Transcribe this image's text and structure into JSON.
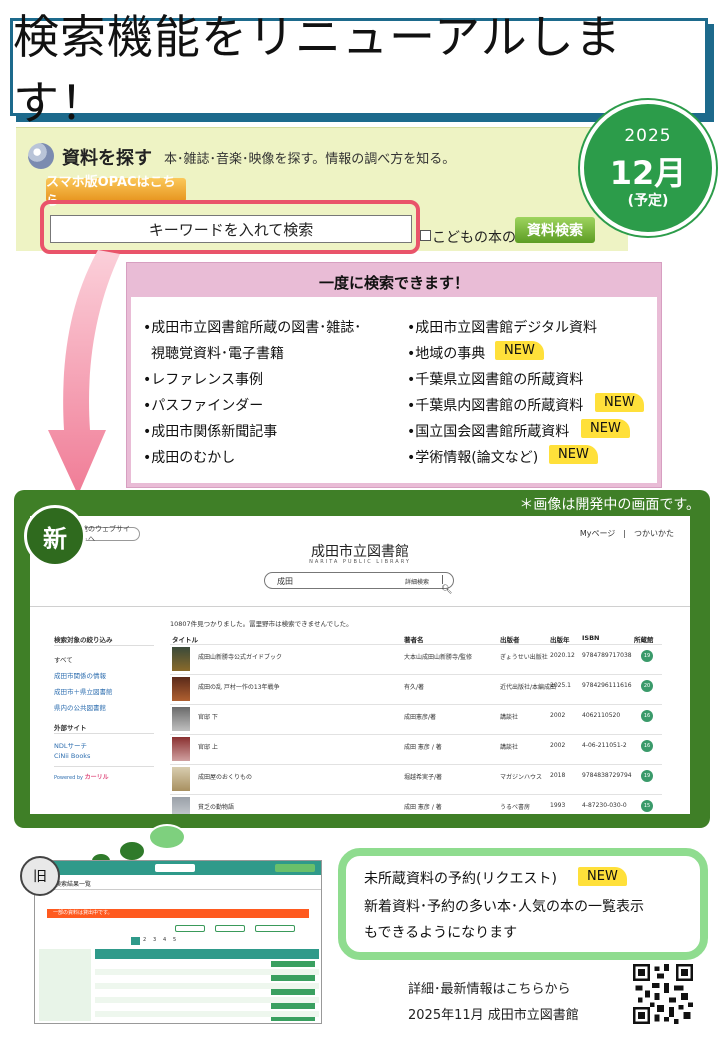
{
  "title": "検索機能をリニューアルします！",
  "old_opac": {
    "heading": "資料を探す",
    "subheading": "本･雑誌･音楽･映像を探す。情報の調べ方を知る。",
    "smartphone_button": "スマホ版OPACはこちら",
    "search_placeholder": "キーワードを入れて検索",
    "kids_only_label": "こどもの本のみ",
    "search_button": "資料検索"
  },
  "release_badge": {
    "year": "2025",
    "month": "12月",
    "note": "(予定)"
  },
  "features": {
    "header": "一度に検索できます！",
    "new_badge_label": "NEW",
    "left": [
      {
        "text": "•成田市立図書館所蔵の図書･雑誌･"
      },
      {
        "text": "視聴覚資料･電子書籍"
      },
      {
        "text": "•レファレンス事例"
      },
      {
        "text": "•パスファインダー"
      },
      {
        "text": "•成田市関係新聞記事"
      },
      {
        "text": "•成田のむかし"
      }
    ],
    "right": [
      {
        "text": "•成田市立図書館デジタル資料",
        "is_new": false
      },
      {
        "text": "•地域の事典",
        "is_new": true
      },
      {
        "text": "•千葉県立図書館の所蔵資料",
        "is_new": false
      },
      {
        "text": "•千葉県内図書館の所蔵資料",
        "is_new": true
      },
      {
        "text": "•国立国会図書館所蔵資料",
        "is_new": true
      },
      {
        "text": "•学術情報(論文など)",
        "is_new": true
      }
    ]
  },
  "new_screen": {
    "badge": "新",
    "dev_note": "＊画像は開発中の画面です。",
    "web_link": "館のウェブサイトへ",
    "top_links": "Myページ　|　つかいかた",
    "library_name": "成田市立図書館",
    "library_name_en": "NARITA PUBLIC LIBRARY",
    "search_value": "成田",
    "advanced_search": "詳細検索",
    "result_count": "10807件見つかりました。冨里野市は検索できませんでした。",
    "sidebar": {
      "filter_heading": "検索対象の絞り込み",
      "filter_items": [
        "すべて",
        "成田市関係の情報",
        "成田市＋県立図書館",
        "県内の公共図書館"
      ],
      "external_heading": "外部サイト",
      "external_items": [
        "NDLサーチ",
        "CiNii Books"
      ],
      "powered_by": "Powered by",
      "powered_brand": "カーリル"
    },
    "columns": [
      "タイトル",
      "著者名",
      "出版者",
      "出版年",
      "ISBN",
      "所蔵館"
    ],
    "rows": [
      {
        "title": "成田山新勝寺公式ガイドブック",
        "author": "大本山成田山新勝寺/監修",
        "publisher": "ぎょうせい出版社",
        "year": "2020.12",
        "isbn": "9784789717038",
        "count": "19"
      },
      {
        "title": "成田の乱 戸村一作の13年戦争",
        "author": "有久/著",
        "publisher": "近代出版社/本編成田",
        "year": "2025.1",
        "isbn": "9784296111616",
        "count": "20"
      },
      {
        "title": "官邸 下",
        "author": "成田憲彦/著",
        "publisher": "講談社",
        "year": "2002",
        "isbn": "4062110520",
        "count": "16"
      },
      {
        "title": "官邸 上",
        "author": "成田 憲彦 / 著",
        "publisher": "講談社",
        "year": "2002",
        "isbn": "4-06-211051-2",
        "count": "16"
      },
      {
        "title": "成田屋のおくりもの",
        "author": "堀越希実子/著",
        "publisher": "マガジンハウス",
        "year": "2018",
        "isbn": "9784838729794",
        "count": "19"
      },
      {
        "title": "貧乏の勤物語",
        "author": "成田 憲彦 / 著",
        "publisher": "うるべ書房",
        "year": "1993",
        "isbn": "4-87230-030-0",
        "count": "15"
      }
    ]
  },
  "old_screen": {
    "badge": "旧",
    "page_title": "検索結果一覧",
    "notice": "一部の資料は貸出中です。",
    "pagination": [
      "1",
      "2",
      "3",
      "4",
      "5"
    ]
  },
  "info": {
    "line1": "未所蔵資料の予約(リクエスト)",
    "line1_badge": "NEW",
    "line2": "新着資料･予約の多い本･人気の本の一覧表示",
    "line3": "もできるようになります"
  },
  "footer": {
    "details": "詳細･最新情報はこちらから",
    "date_org": "2025年11月  成田市立図書館"
  },
  "colors": {
    "title_border": "#1d6a8c",
    "highlight_red": "#e9546a",
    "badge_green": "#2c9c4a",
    "panel_green": "#3f7f27",
    "feature_pink": "#e9bcd6",
    "new_yellow": "#ffe03a",
    "bubble_green": "#8fdc8f"
  }
}
